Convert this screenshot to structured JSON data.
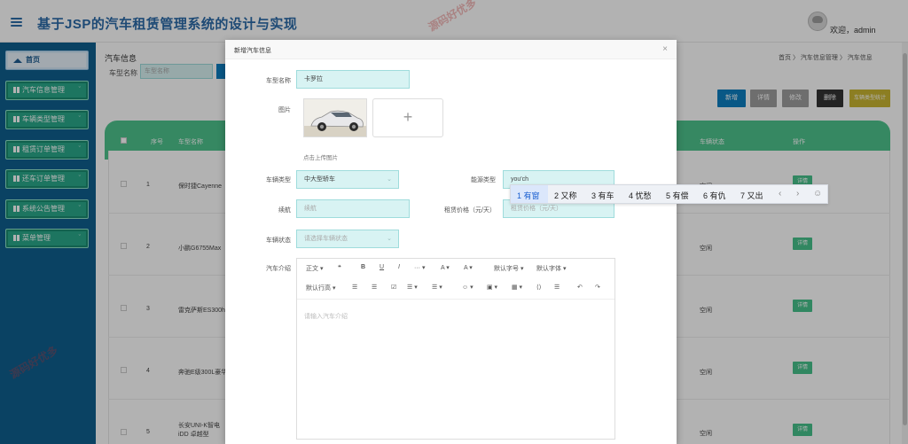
{
  "header": {
    "title": "基于JSP的汽车租赁管理系统的设计与实现",
    "welcome": "欢迎，admin"
  },
  "sidebar": {
    "items": [
      {
        "label": "首页",
        "icon": "home-icon"
      },
      {
        "label": "汽车信息管理",
        "icon": "grid-icon"
      },
      {
        "label": "车辆类型管理",
        "icon": "grid-icon"
      },
      {
        "label": "租赁订单管理",
        "icon": "grid-icon"
      },
      {
        "label": "还车订单管理",
        "icon": "grid-icon"
      },
      {
        "label": "系统公告管理",
        "icon": "grid-icon"
      },
      {
        "label": "菜单管理",
        "icon": "grid-icon"
      }
    ]
  },
  "content": {
    "title": "汽车信息",
    "breadcrumb": "首页 〉 汽车信息管理 〉 汽车信息",
    "search_label": "车型名称",
    "search_placeholder": "车型名称",
    "toolbar": [
      "新增",
      "详情",
      "修改",
      "删除",
      "车辆类型统计"
    ],
    "columns": [
      "序号",
      "车型名称",
      "车辆状态",
      "操作"
    ],
    "rows": [
      {
        "no": "1",
        "name": "保时捷Cayenne",
        "status": "空闲",
        "action": "详情"
      },
      {
        "no": "2",
        "name": "小鹏G6755Max",
        "status": "空闲",
        "action": "详情"
      },
      {
        "no": "3",
        "name": "雷克萨斯ES300h",
        "status": "空闲",
        "action": "详情"
      },
      {
        "no": "4",
        "name": "奔驰E级300L豪华",
        "status": "空闲",
        "action": "详情"
      },
      {
        "no": "5",
        "name": "长安UNI-K智电iDD 卓越型",
        "status": "空闲",
        "action": "详情"
      }
    ]
  },
  "modal": {
    "title": "新增汽车信息",
    "close": "×",
    "fields": {
      "model_label": "车型名称",
      "model_value": "卡罗拉",
      "image_label": "图片",
      "upload_plus": "+",
      "upload_hint": "点击上传图片",
      "type_label": "车辆类型",
      "type_value": "中大型轿车",
      "energy_label": "能源类型",
      "energy_value": "you'ch",
      "range_label": "续航",
      "range_placeholder": "续航",
      "price_label": "租赁价格（元/天）",
      "price_placeholder": "租赁价格（元/天）",
      "status_label": "车辆状态",
      "status_placeholder": "请选择车辆状态",
      "intro_label": "汽车介绍",
      "intro_placeholder": "请输入汽车介绍"
    },
    "editor_toolbar": {
      "row1": [
        "正文 ▾",
        "❝",
        "B",
        "U",
        "I",
        "··· ▾",
        "A ▾",
        "A ▾",
        "默认字号 ▾",
        "默认字体 ▾"
      ],
      "row2": [
        "默认行高 ▾",
        "☰",
        "☰",
        "☑",
        "☰ ▾",
        "☰ ▾",
        "☺ ▾",
        "▣ ▾",
        "▦ ▾",
        "⟨⟩",
        "☰",
        "↶",
        "↷"
      ]
    }
  },
  "ime": {
    "candidates": [
      "1 有窗",
      "2 又称",
      "3 有车",
      "4 忧愁",
      "5 有偿",
      "6 有仇",
      "7 又出"
    ],
    "nav_prev": "‹",
    "nav_next": "›",
    "emoji": "☺"
  },
  "watermark": "源码好优多",
  "colors": {
    "brand": "#2b6aa8",
    "sidebar": "#0f5f8f",
    "accent_green": "#4ec38d",
    "primary": "#0d7fc0"
  }
}
